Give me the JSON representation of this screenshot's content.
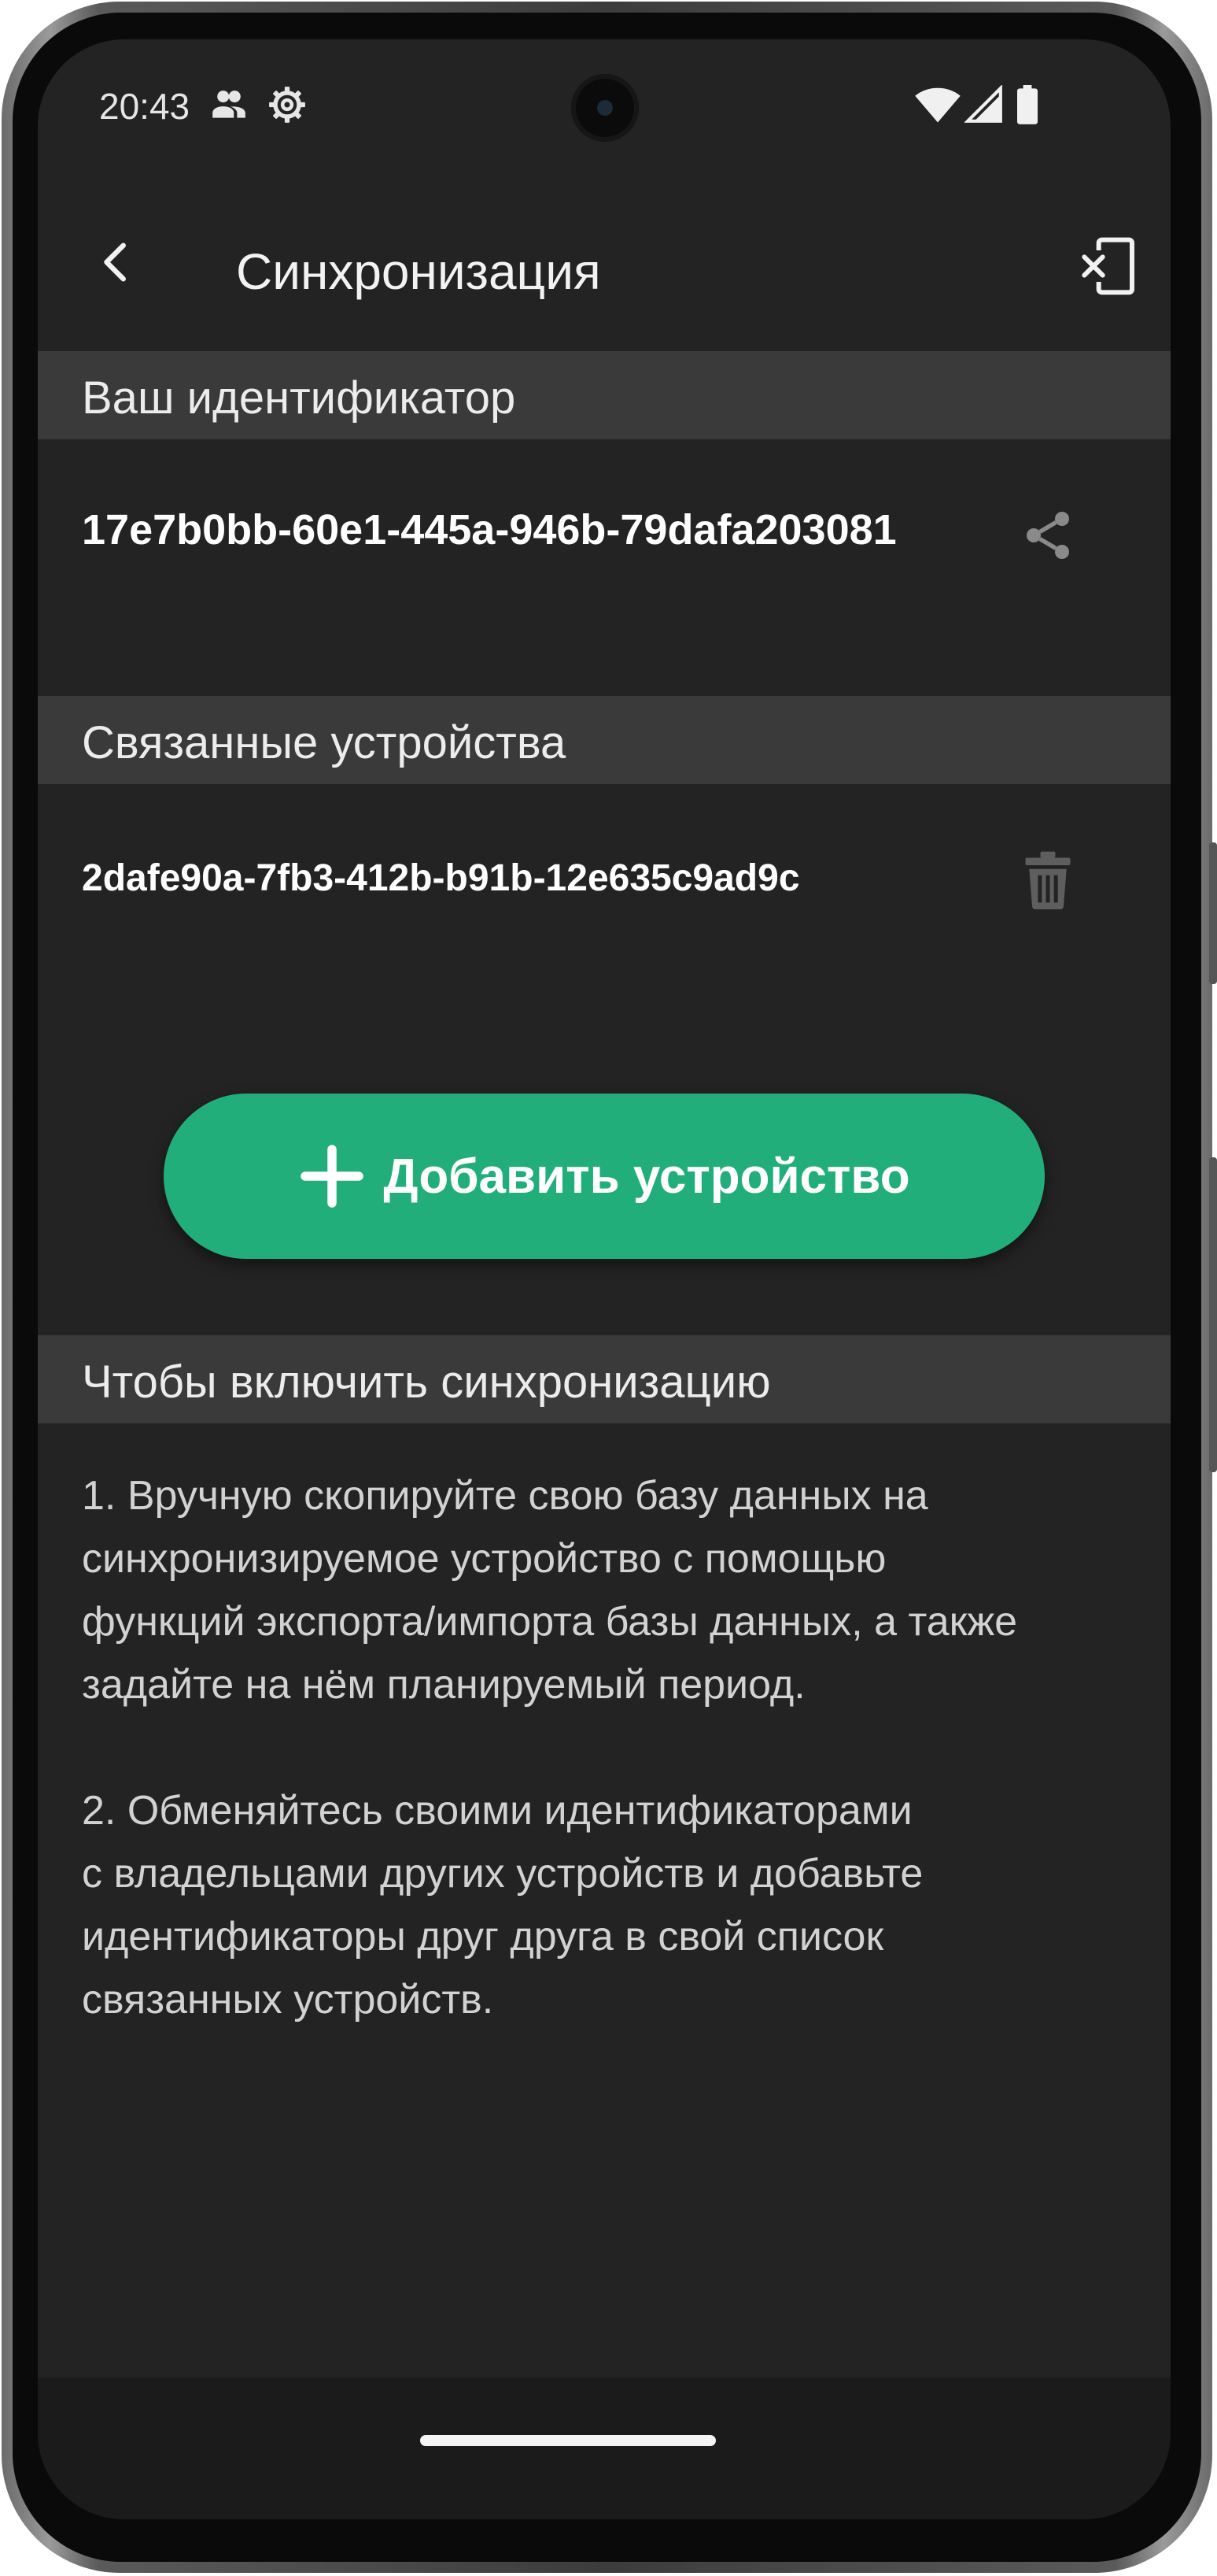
{
  "status_bar": {
    "time": "20:43",
    "icons": [
      "users-icon",
      "gear-icon",
      "wifi-icon",
      "signal-icon",
      "battery-icon"
    ]
  },
  "app_bar": {
    "title": "Синхронизация",
    "back_icon": "back-arrow-icon",
    "action_icon": "exit-sync-icon"
  },
  "your_id": {
    "header": "Ваш идентификатор",
    "value": "17e7b0bb-60e1-445a-946b-79dafa203081",
    "action_icon": "share-icon"
  },
  "linked_devices": {
    "header": "Связанные устройства",
    "items": [
      {
        "id": "2dafe90a-7fb3-412b-b91b-12e635c9ad9c",
        "action_icon": "trash-icon"
      }
    ]
  },
  "add_button": {
    "label": "Добавить устройство",
    "icon": "plus-icon"
  },
  "instructions": {
    "header": "Чтобы включить синхронизацию",
    "step1": "1. Вручную скопируйте свою базу данных на\nсинхронизируемое устройство с помощью\nфункций экспорта/импорта базы данных, а также\nзадайте на нём планируемый период.",
    "step2": "2. Обменяйтесь своими идентификаторами\nс владельцами других устройств и добавьте\nидентификаторы друг друга в свой список\nсвязанных устройств."
  },
  "colors": {
    "background": "#232323",
    "section_header": "#3a3a3a",
    "accent": "#22ae7a",
    "text_primary": "#ffffff",
    "text_secondary": "#d2d2d2",
    "icon_muted": "#8a8a8a"
  }
}
